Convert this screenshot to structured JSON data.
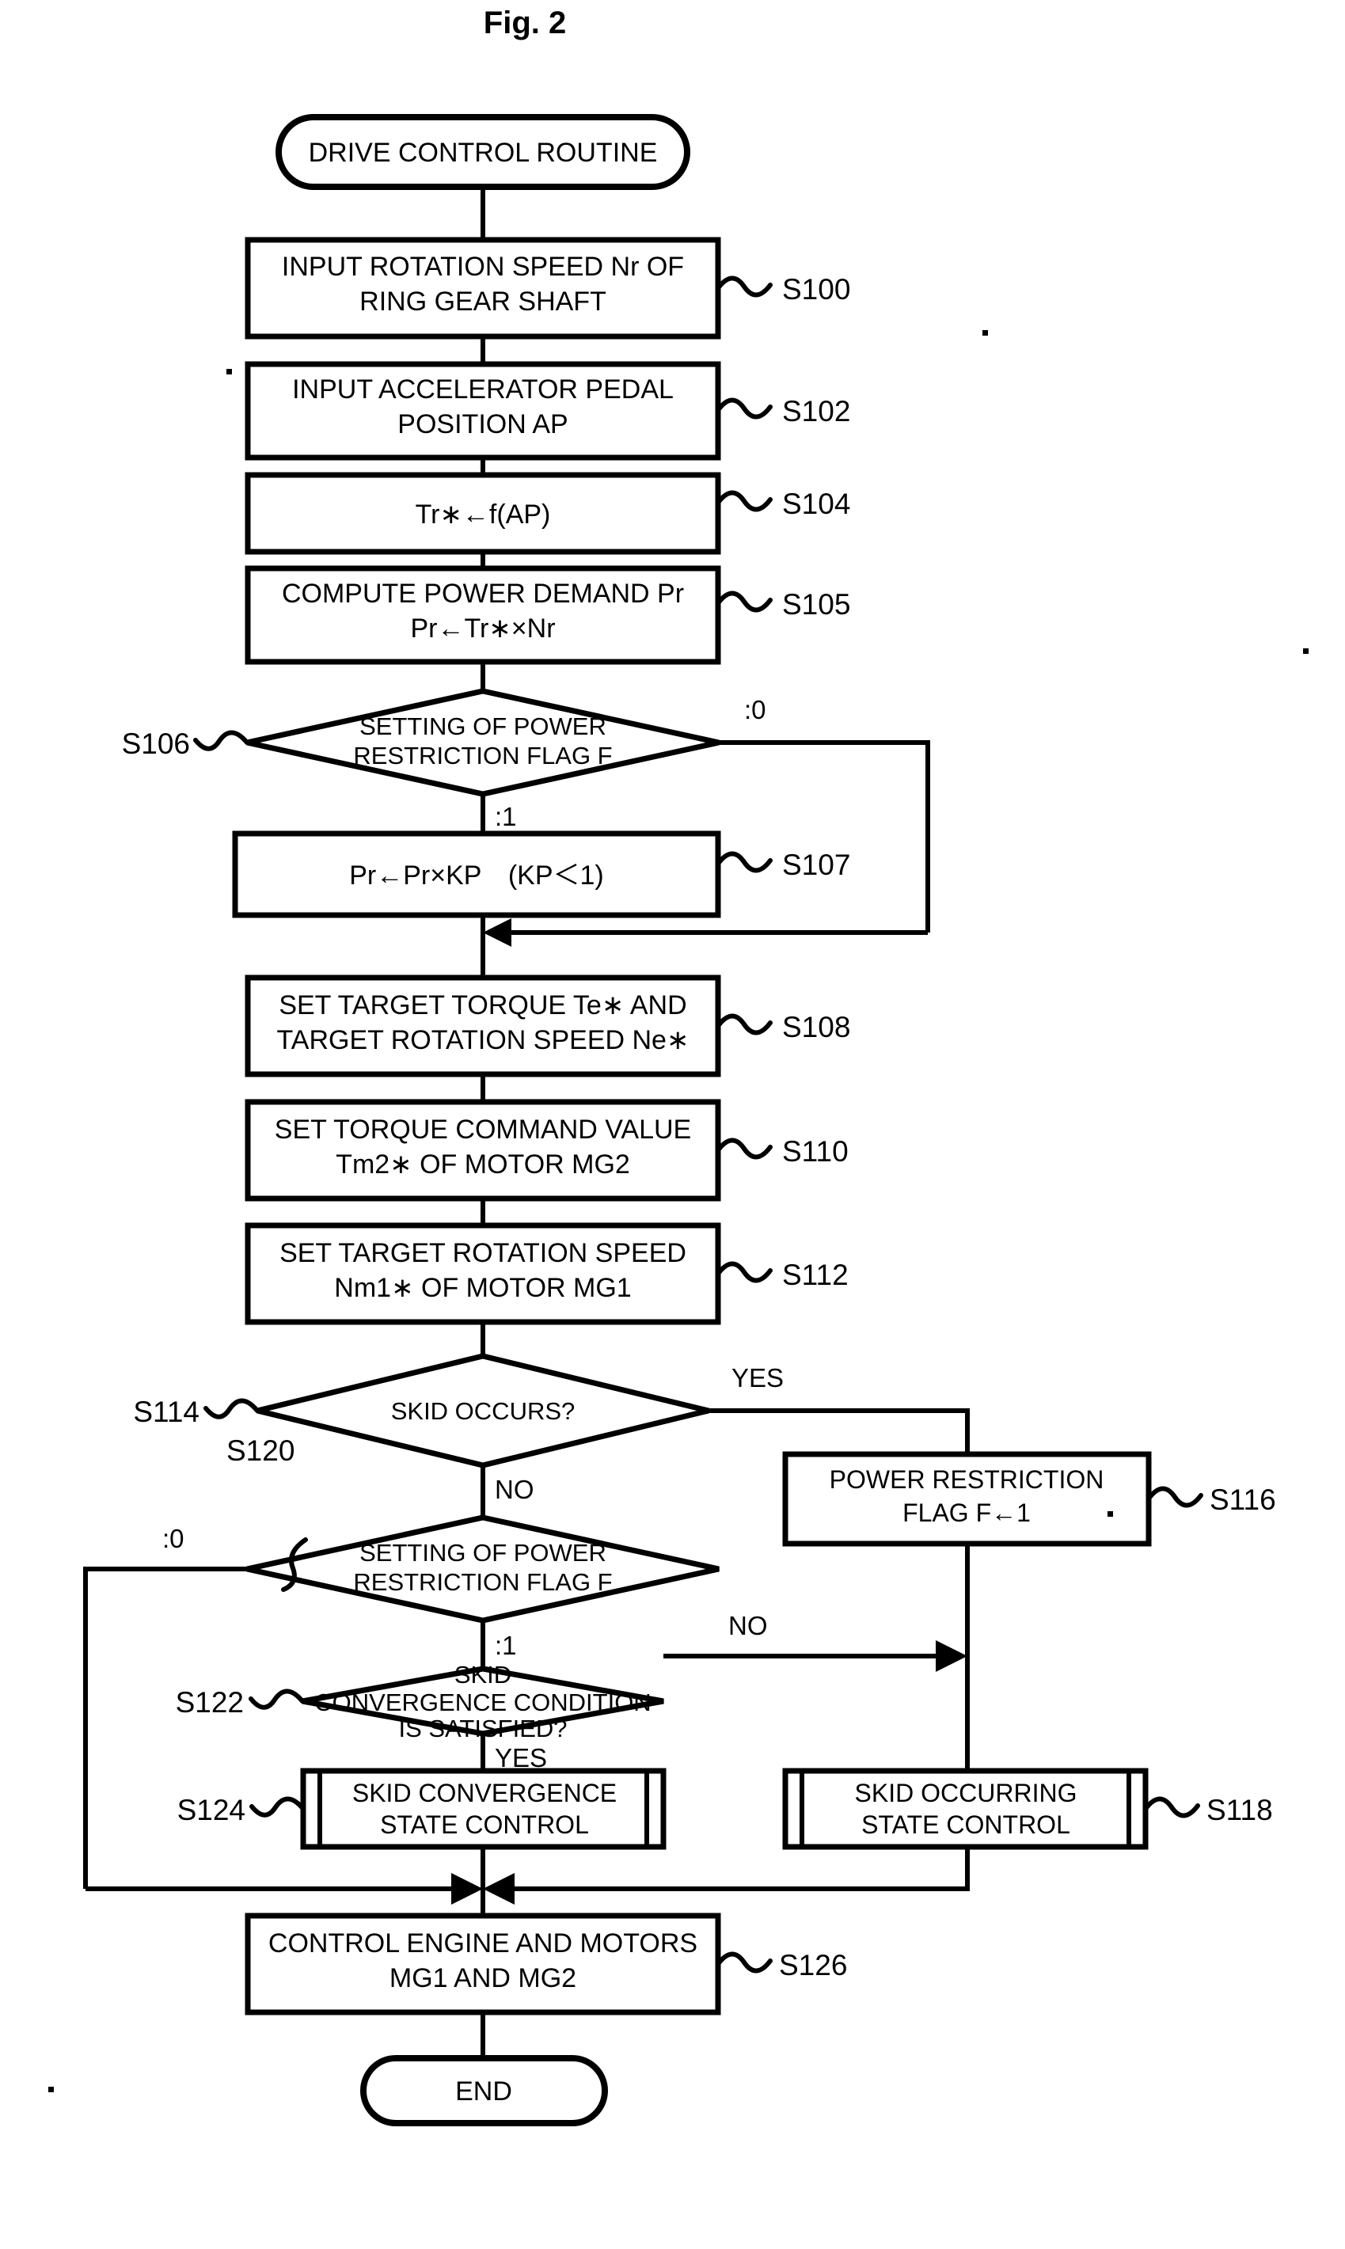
{
  "figure": {
    "title": "Fig. 2"
  },
  "nodes": {
    "start": {
      "label": "DRIVE CONTROL ROUTINE"
    },
    "s100": {
      "step": "S100",
      "lines": [
        "INPUT ROTATION SPEED Nr OF",
        "RING GEAR SHAFT"
      ]
    },
    "s102": {
      "step": "S102",
      "lines": [
        "INPUT ACCELERATOR PEDAL",
        "POSITION AP"
      ]
    },
    "s104": {
      "step": "S104",
      "lines": [
        "Tr∗←f(AP)"
      ]
    },
    "s105": {
      "step": "S105",
      "lines": [
        "COMPUTE POWER DEMAND Pr",
        "Pr←Tr∗×Nr"
      ]
    },
    "s106": {
      "step": "S106",
      "lines": [
        "SETTING OF POWER",
        "RESTRICTION FLAG F"
      ],
      "branch_right": ":0",
      "branch_down": ":1"
    },
    "s107": {
      "step": "S107",
      "lines": [
        "Pr←Pr×KP　(KP＜1)"
      ]
    },
    "s108": {
      "step": "S108",
      "lines": [
        "SET TARGET TORQUE Te∗ AND",
        "TARGET ROTATION SPEED Ne∗"
      ]
    },
    "s110": {
      "step": "S110",
      "lines": [
        "SET TORQUE COMMAND VALUE",
        "Tm2∗ OF MOTOR MG2"
      ]
    },
    "s112": {
      "step": "S112",
      "lines": [
        "SET TARGET ROTATION SPEED",
        "Nm1∗ OF MOTOR MG1"
      ]
    },
    "s114": {
      "step": "S114",
      "lines": [
        "SKID OCCURS?"
      ],
      "branch_right": "YES",
      "branch_down": "NO"
    },
    "s116": {
      "step": "S116",
      "lines": [
        "POWER RESTRICTION",
        "FLAG F←1"
      ]
    },
    "s118": {
      "step": "S118",
      "lines": [
        "SKID OCCURRING",
        "STATE CONTROL"
      ]
    },
    "s120": {
      "step": "S120",
      "lines": [
        "SETTING OF POWER",
        "RESTRICTION FLAG F"
      ],
      "branch_left": ":0",
      "branch_down": ":1"
    },
    "s122": {
      "step": "S122",
      "lines": [
        "SKID",
        "CONVERGENCE CONDITION",
        "IS SATISFIED?"
      ],
      "branch_right": "NO",
      "branch_down": "YES"
    },
    "s124": {
      "step": "S124",
      "lines": [
        "SKID CONVERGENCE",
        "STATE CONTROL"
      ]
    },
    "s126": {
      "step": "S126",
      "lines": [
        "CONTROL ENGINE AND MOTORS",
        "MG1 AND MG2"
      ]
    },
    "end": {
      "label": "END"
    }
  },
  "colors": {
    "ink": "#000000",
    "paper": "#ffffff"
  }
}
